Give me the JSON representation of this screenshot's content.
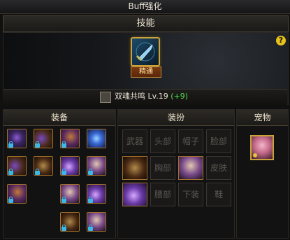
{
  "window": {
    "title": "Buff强化"
  },
  "skill": {
    "header": "技能",
    "badge": "精通",
    "name": "双魂共鸣",
    "level": "Lv.19",
    "bonus": "(+9)",
    "help": "?"
  },
  "equipment": {
    "title": "装备",
    "items": [
      {
        "variant": "v1",
        "lock": true
      },
      {
        "variant": "v2",
        "lock": true
      },
      {
        "variant": "v3",
        "lock": true
      },
      {
        "variant": "v4",
        "lock": false
      },
      {
        "variant": "v2",
        "lock": true
      },
      {
        "variant": "v7",
        "lock": true
      },
      {
        "variant": "v5",
        "lock": true
      },
      {
        "variant": "v6",
        "lock": true
      },
      {
        "variant": "v3",
        "lock": true
      },
      {
        "variant": "v6",
        "lock": true
      },
      {
        "variant": "v5",
        "lock": true
      },
      {
        "variant": "v7",
        "lock": true
      },
      {
        "variant": "v6",
        "lock": true
      }
    ]
  },
  "avatar": {
    "title": "装扮",
    "slots": [
      {
        "label": "武器"
      },
      {
        "label": "头部"
      },
      {
        "label": "帽子"
      },
      {
        "label": "脸部"
      },
      {
        "label": ""
      },
      {
        "label": "胸部"
      },
      {
        "label": ""
      },
      {
        "label": "皮肤"
      },
      {
        "label": ""
      },
      {
        "label": "腰部"
      },
      {
        "label": "下装"
      },
      {
        "label": "鞋"
      }
    ]
  },
  "pet": {
    "title": "宠物"
  }
}
